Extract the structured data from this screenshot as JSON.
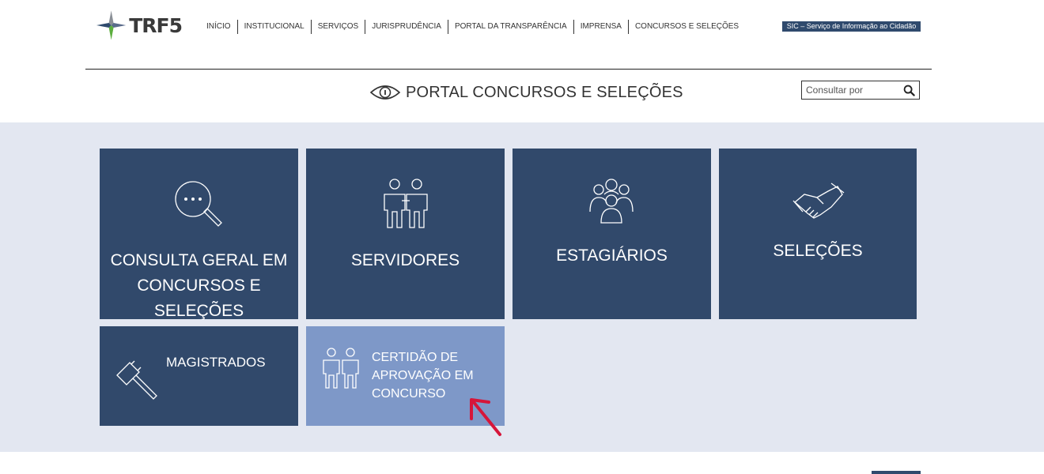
{
  "header": {
    "logo_text": "TRF5",
    "nav": [
      {
        "label": "INÍCIO"
      },
      {
        "label": "INSTITUCIONAL"
      },
      {
        "label": "SERVIÇOS"
      },
      {
        "label": "JURISPRUDÊNCIA"
      },
      {
        "label": "PORTAL DA TRANSPARÊNCIA"
      },
      {
        "label": "IMPRENSA"
      },
      {
        "label": "CONCURSOS E SELEÇÕES"
      }
    ],
    "sic_label": "SIC – Serviço de Informação ao Cidadão"
  },
  "portal": {
    "title": "PORTAL CONCURSOS E SELEÇÕES",
    "search_placeholder": "Consultar por"
  },
  "tiles": [
    {
      "label": "CONSULTA GERAL EM CONCURSOS E SELEÇÕES",
      "icon": "magnifier-icon"
    },
    {
      "label": "SERVIDORES",
      "icon": "workers-icon"
    },
    {
      "label": "ESTAGIÁRIOS",
      "icon": "group-icon"
    },
    {
      "label": "SELEÇÕES",
      "icon": "handshake-icon"
    },
    {
      "label": "MAGISTRADOS",
      "icon": "gavel-icon"
    },
    {
      "label": "CERTIDÃO DE APROVAÇÃO EM CONCURSO",
      "icon": "workers-icon"
    }
  ],
  "colors": {
    "tile_dark": "#31496b",
    "tile_highlight": "#7e98c8",
    "band": "#e3e7f1",
    "arrow": "#d6163a"
  }
}
